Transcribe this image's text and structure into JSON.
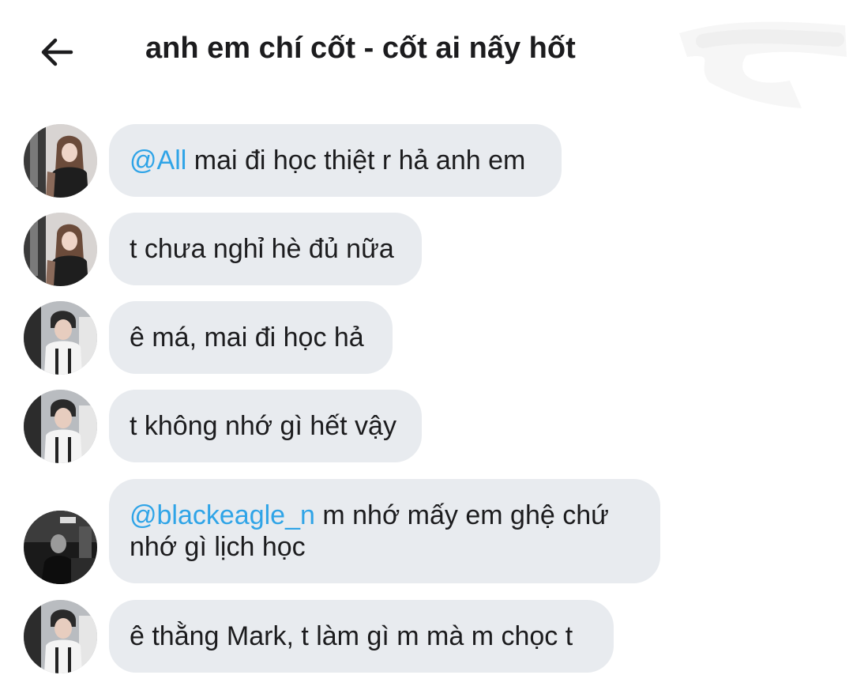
{
  "header": {
    "back_icon": "arrow-left-icon",
    "title": "anh em chí cốt - cốt ai nấy hốt"
  },
  "colors": {
    "bubble_bg": "#e8ebef",
    "mention": "#2fa4e7",
    "text": "#1c1c1e"
  },
  "messages": [
    {
      "avatar": "avatar-user-1",
      "mention": "@All",
      "text": " mai đi học thiệt r hả anh em"
    },
    {
      "avatar": "avatar-user-1",
      "text": "t chưa nghỉ hè đủ nữa"
    },
    {
      "avatar": "avatar-user-2",
      "text": "ê má, mai đi học hả"
    },
    {
      "avatar": "avatar-user-2",
      "text": "t không nhớ gì hết vậy"
    },
    {
      "avatar": "avatar-user-3",
      "mention": "@blackeagle_n",
      "text": " m nhớ mấy em ghệ chứ",
      "text_line2": "nhớ gì lịch học"
    },
    {
      "avatar": "avatar-user-2",
      "text": "ê thằng Mark, t làm gì m mà m chọc t"
    }
  ]
}
